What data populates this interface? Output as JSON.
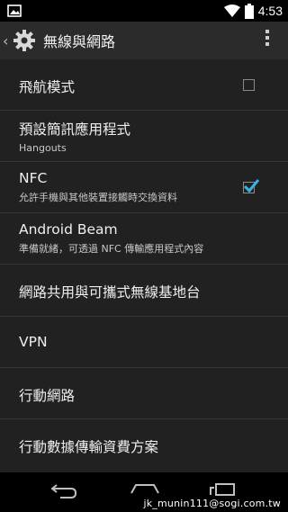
{
  "status_bar": {
    "time": "4:53",
    "icons": [
      "image-icon",
      "wifi-icon",
      "battery-icon"
    ]
  },
  "action_bar": {
    "title": "無線與網路",
    "icons": [
      "up-chevron-icon",
      "settings-gear-icon",
      "overflow-menu-icon"
    ]
  },
  "items": [
    {
      "title": "飛航模式",
      "checkbox": true,
      "checked": false
    },
    {
      "title": "預設簡訊應用程式",
      "summary": "Hangouts"
    },
    {
      "title": "NFC",
      "summary": "允許手機與其他裝置接觸時交換資料",
      "checkbox": true,
      "checked": true
    },
    {
      "title": "Android Beam",
      "summary": "準備就緒，可透過 NFC 傳輸應用程式內容"
    },
    {
      "title": "網路共用與可攜式無線基地台"
    },
    {
      "title": "VPN"
    },
    {
      "title": "行動網路"
    },
    {
      "title": "行動數據傳輸資費方案"
    }
  ],
  "accent_color": "#33b5e5",
  "watermark": "jk_munin111@sogi.com.tw"
}
